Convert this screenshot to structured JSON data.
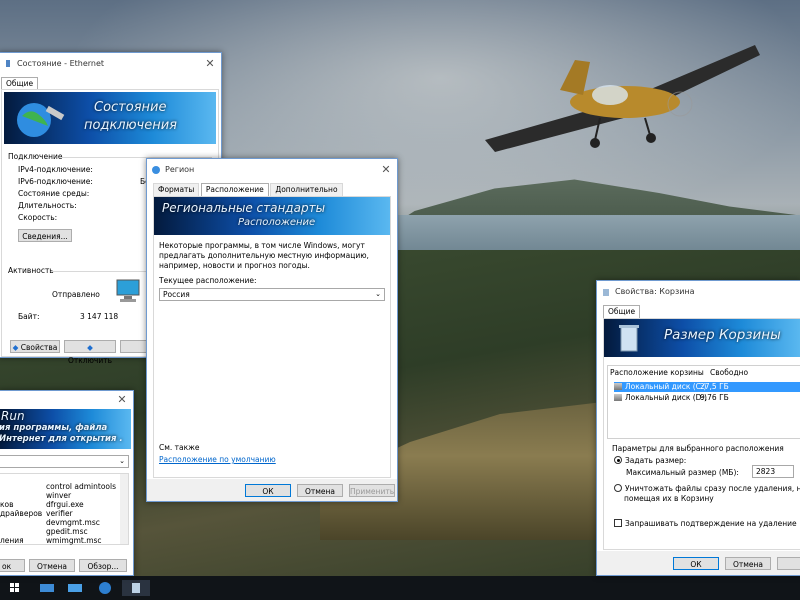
{
  "ethernet": {
    "title": "Состояние - Ethernet",
    "tab": "Общие",
    "banner": [
      "Состояние",
      "подключения"
    ],
    "section_connection": "Подключение",
    "rows": [
      "IPv4-подключение:",
      "IPv6-подключение:",
      "Состояние среды:",
      "Длительность:",
      "Скорость:"
    ],
    "ipv6_value_partial": "Бе",
    "details_button": "Сведения...",
    "section_activity": "Активность",
    "sent_label": "Отправлено",
    "bytes_label": "Байт:",
    "bytes_value": "3 147 118",
    "properties_button": "Свойства",
    "disable_button": "Отключить",
    "diagnose_partial": "Д"
  },
  "region": {
    "title": "Регион",
    "tabs": [
      "Форматы",
      "Расположение",
      "Дополнительно"
    ],
    "banner": [
      "Региональные стандарты",
      "Расположение"
    ],
    "description": "Некоторые программы, в том числе Windows, могут предлагать дополнительную местную информацию, например, новости и прогноз погоды.",
    "current_location_label": "Текущее расположение:",
    "current_location_value": "Россия",
    "see_also": "См. также",
    "default_location_link": "Расположение по умолчанию",
    "ok": "ОК",
    "cancel": "Отмена",
    "apply": "Применить"
  },
  "recycle": {
    "title": "Свойства: Корзина",
    "tab": "Общие",
    "banner": "Размер Корзины",
    "col_location": "Расположение корзины",
    "col_free": "Свободно",
    "drives": [
      {
        "name": "Локальный диск (C:)",
        "free": "27,5 ГБ"
      },
      {
        "name": "Локальный диск (D:)",
        "free": "9,76 ГБ"
      }
    ],
    "params_label": "Параметры для выбранного расположения",
    "custom_size": "Задать размер:",
    "max_size_label": "Максимальный размер (МБ):",
    "max_size_value": "2823",
    "no_move_line1": "Уничтожать файлы сразу после удаления, не",
    "no_move_line2": "помещая их в Корзину",
    "confirm_delete": "Запрашивать подтверждение на удаление",
    "ok": "ОК",
    "cancel": "Отмена"
  },
  "run": {
    "banner": [
      "Run",
      "ия программы, файла",
      "Интернет для открытия ."
    ],
    "commands_col1": [
      "control admintools",
      "winver",
      "dfrgui.exe",
      "verifier",
      "devmgmt.msc",
      "gpedit.msc",
      "wmimgmt.msc"
    ],
    "commands_col0": [
      "",
      "",
      "ков",
      "драйверов",
      "",
      "",
      "ления"
    ],
    "ok_partial": "ок",
    "cancel": "Отмена",
    "browse": "Обзор..."
  },
  "colors": {
    "accent": "#0078d7",
    "selection": "#3399ff",
    "taskbar": "#101418"
  }
}
